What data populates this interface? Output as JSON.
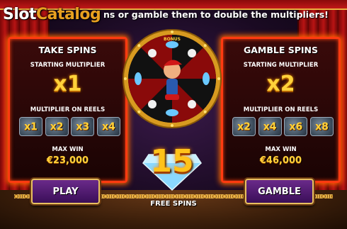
{
  "logo": {
    "part1": "Slot",
    "part2": "Catalog"
  },
  "banner": {
    "text": "ns or gamble them to double the multipliers!"
  },
  "take_panel": {
    "title": "TAKE SPINS",
    "starting_label": "STARTING MULTIPLIER",
    "starting_value": "x1",
    "reels_label": "MULTIPLIER ON REELS",
    "reels": [
      "x1",
      "x2",
      "x3",
      "x4"
    ],
    "max_label": "MAX WIN",
    "max_value": "€23,000",
    "button": "PLAY"
  },
  "gamble_panel": {
    "title": "GAMBLE SPINS",
    "starting_label": "STARTING MULTIPLIER",
    "starting_value": "x2",
    "reels_label": "MULTIPLIER ON REELS",
    "reels": [
      "x2",
      "x4",
      "x6",
      "x8"
    ],
    "max_label": "MAX WIN",
    "max_value": "€46,000",
    "button": "GAMBLE"
  },
  "wheel": {
    "segment_label": "BONUS"
  },
  "free_spins": {
    "count": "15",
    "label": "FREE SPINS"
  },
  "colors": {
    "accent_gold": "#ffd23a",
    "panel_border": "#ff3a10",
    "button_purple": "#4a1a6a"
  }
}
